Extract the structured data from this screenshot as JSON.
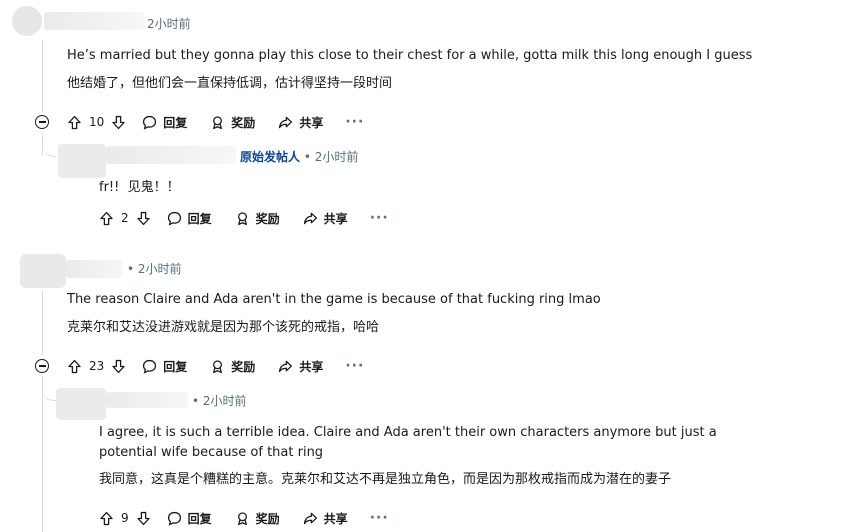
{
  "comments": [
    {
      "time": "2小时前",
      "text_en": "He’s married but they gonna play this close to their chest for a while, gotta milk this long enough I guess",
      "text_zh": "他结婚了，但他们会一直保持低调，估计得坚持一段时间",
      "votes": "10",
      "reply": "回复",
      "award": "奖励",
      "share": "共享",
      "more": "···"
    },
    {
      "badge": "原始发帖人",
      "time": "• 2小时前",
      "text_en": "fr!!",
      "text_zh": "见鬼！！",
      "votes": "2",
      "reply": "回复",
      "award": "奖励",
      "share": "共享",
      "more": "···"
    },
    {
      "time": "• 2小时前",
      "text_en": "The reason Claire and Ada aren't in the game is because of that fucking ring lmao",
      "text_zh": "克莱尔和艾达没进游戏就是因为那个该死的戒指，哈哈",
      "votes": "23",
      "reply": "回复",
      "award": "奖励",
      "share": "共享",
      "more": "···"
    },
    {
      "time": "• 2小时前",
      "text_en": "I agree, it is such a terrible idea. Claire and Ada aren't their own characters anymore but just a potential wife because of that ring",
      "text_zh": "我同意，这真是个糟糕的主意。克莱尔和艾达不再是独立角色，而是因为那枚戒指而成为潜在的妻子",
      "votes": "9",
      "reply": "回复",
      "award": "奖励",
      "share": "共享",
      "more": "···"
    }
  ]
}
